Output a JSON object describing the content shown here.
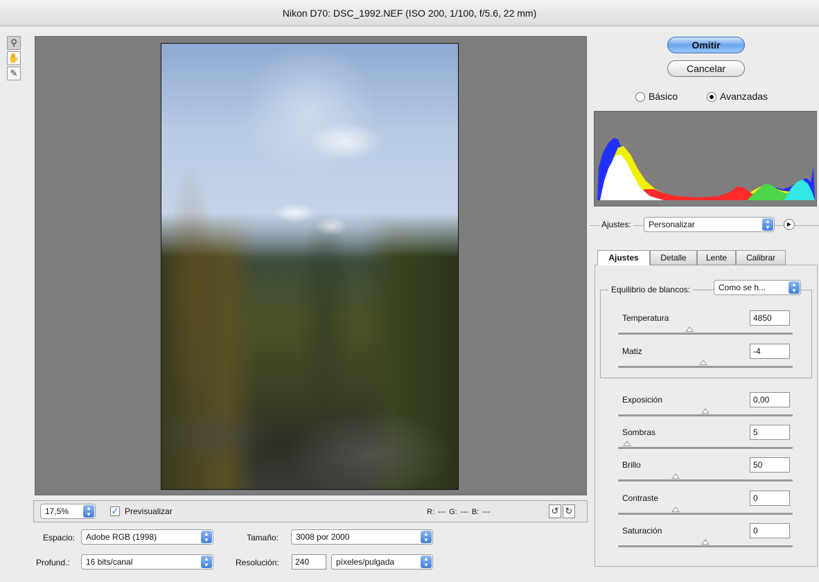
{
  "window": {
    "title": "Nikon D70:  DSC_1992.NEF  (ISO 200, 1/100, f/5.6, 22 mm)"
  },
  "tools": [
    {
      "name": "zoom-tool",
      "icon": "magnifier-icon",
      "glyph": "🔍"
    },
    {
      "name": "hand-tool",
      "icon": "hand-icon",
      "glyph": "✋"
    },
    {
      "name": "eyedropper-tool",
      "icon": "eyedropper-icon",
      "glyph": "✒"
    }
  ],
  "buttons": {
    "omit": "Omitir",
    "cancel": "Cancelar"
  },
  "mode": {
    "basic": "Básico",
    "advanced": "Avanzadas",
    "selected": "advanced"
  },
  "histogram_colors": {
    "blue": "#2230ff",
    "yellow": "#f0f000",
    "red": "#ff2a2a",
    "green": "#4ad74a",
    "cyan": "#35e6e6",
    "white": "#ffffff"
  },
  "settings": {
    "label": "Ajustes:",
    "value": "Personalizar"
  },
  "tabs": [
    {
      "label": "Ajustes",
      "active": true
    },
    {
      "label": "Detalle",
      "active": false
    },
    {
      "label": "Lente",
      "active": false
    },
    {
      "label": "Calibrar",
      "active": false
    }
  ],
  "white_balance": {
    "label": "Equilibrio de blancos:",
    "value": "Como se h..."
  },
  "sliders": [
    {
      "label": "Temperatura",
      "value": "4850",
      "position": 0.41
    },
    {
      "label": "Matiz",
      "value": "-4",
      "position": 0.49
    },
    {
      "label": "Exposición",
      "value": "0,00",
      "position": 0.5
    },
    {
      "label": "Sombras",
      "value": "5",
      "position": 0.05
    },
    {
      "label": "Brillo",
      "value": "50",
      "position": 0.33
    },
    {
      "label": "Contraste",
      "value": "0",
      "position": 0.33
    },
    {
      "label": "Saturación",
      "value": "0",
      "position": 0.5
    }
  ],
  "toolbar": {
    "zoom": "17,5%",
    "preview_label": "Previsualizar",
    "preview_checked": true,
    "rgb_readout": "R: ---  G: ---  B: ---"
  },
  "output": {
    "space_label": "Espacio:",
    "space_value": "Adobe RGB (1998)",
    "depth_label": "Profund.:",
    "depth_value": "16 bits/canal",
    "size_label": "Tamaño:",
    "size_value": "3008 por 2000",
    "resolution_label": "Resolución:",
    "resolution_value": "240",
    "resolution_unit": "píxeles/pulgada"
  }
}
